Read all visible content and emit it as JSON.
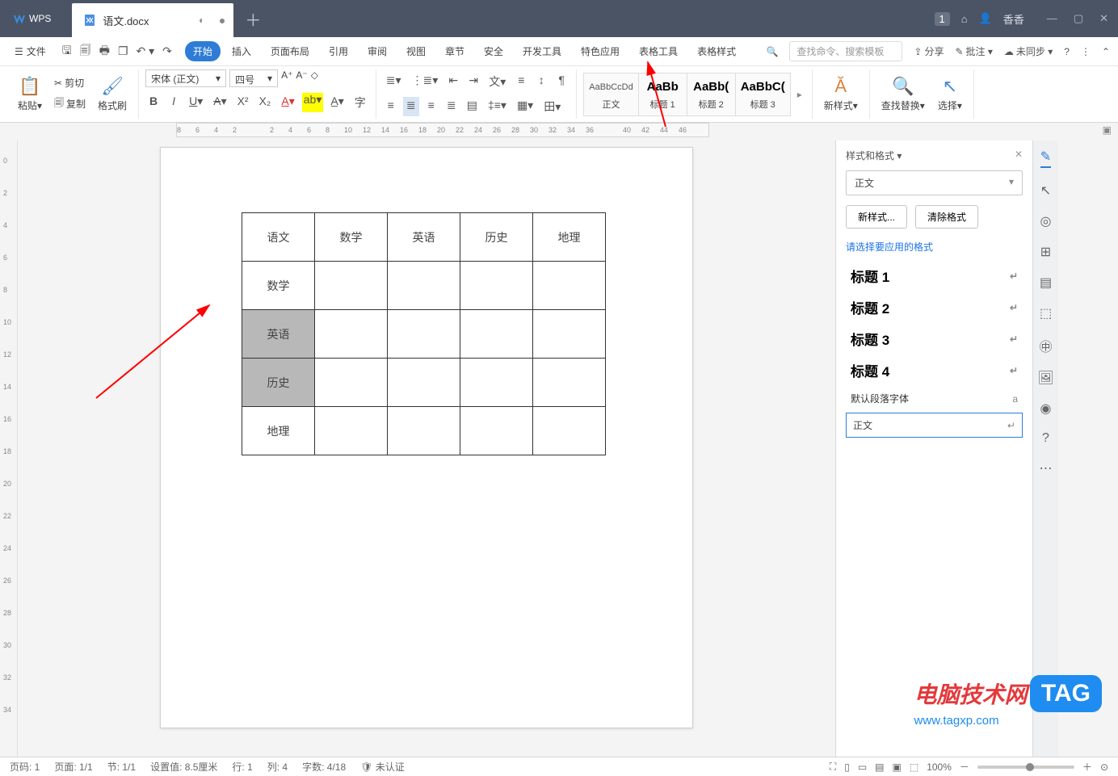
{
  "titlebar": {
    "logo_text": "WPS",
    "tab_name": "语文.docx",
    "user": "香香",
    "badge": "1"
  },
  "menubar": {
    "file": "文件",
    "tabs": [
      "开始",
      "插入",
      "页面布局",
      "引用",
      "审阅",
      "视图",
      "章节",
      "安全",
      "开发工具",
      "特色应用",
      "表格工具",
      "表格样式"
    ],
    "active_tab": "开始",
    "search_placeholder": "查找命令、搜索模板",
    "share": "分享",
    "annotate": "批注 ▾",
    "sync": "未同步 ▾"
  },
  "ribbon": {
    "paste": "粘贴▾",
    "cut": "剪切",
    "copy": "复制",
    "format_painter": "格式刷",
    "font_name": "宋体 (正文)",
    "font_size": "四号",
    "styles": [
      {
        "preview": "AaBbCcDd",
        "name": "正文"
      },
      {
        "preview": "AaBb",
        "name": "标题 1",
        "big": true
      },
      {
        "preview": "AaBb(",
        "name": "标题 2",
        "big": true
      },
      {
        "preview": "AaBbC(",
        "name": "标题 3",
        "big": true
      }
    ],
    "new_style": "新样式▾",
    "find_replace": "查找替换▾",
    "select": "选择▾"
  },
  "document": {
    "table": {
      "rows": [
        [
          "语文",
          "数学",
          "英语",
          "历史",
          "地理"
        ],
        [
          "数学",
          "",
          "",
          "",
          ""
        ],
        [
          "英语",
          "",
          "",
          "",
          ""
        ],
        [
          "历史",
          "",
          "",
          "",
          ""
        ],
        [
          "地理",
          "",
          "",
          "",
          ""
        ]
      ],
      "selected_rows": [
        2,
        3
      ]
    }
  },
  "styles_panel": {
    "title": "样式和格式 ▾",
    "current": "正文",
    "btn_new": "新样式...",
    "btn_clear": "清除格式",
    "hint": "请选择要应用的格式",
    "list": [
      {
        "name": "标题 1",
        "type": "h"
      },
      {
        "name": "标题 2",
        "type": "h"
      },
      {
        "name": "标题 3",
        "type": "h"
      },
      {
        "name": "标题 4",
        "type": "h"
      },
      {
        "name": "默认段落字体",
        "type": "small",
        "mark": "a"
      },
      {
        "name": "正文",
        "type": "boxed"
      }
    ]
  },
  "statusbar": {
    "page_no": "页码: 1",
    "page_count": "页面: 1/1",
    "section": "节: 1/1",
    "pos": "设置值: 8.5厘米",
    "line": "行: 1",
    "col": "列: 4",
    "chars": "字数: 4/18",
    "auth": "未认证",
    "zoom": "100%"
  },
  "watermark": {
    "text": "电脑技术网",
    "tag": "TAG",
    "url": "www.tagxp.com"
  },
  "ruler_marks": [
    "8",
    "6",
    "4",
    "2",
    "",
    "2",
    "4",
    "6",
    "8",
    "10",
    "12",
    "14",
    "16",
    "18",
    "20",
    "22",
    "24",
    "26",
    "28",
    "30",
    "32",
    "34",
    "36",
    "",
    "40",
    "42",
    "44",
    "46"
  ]
}
